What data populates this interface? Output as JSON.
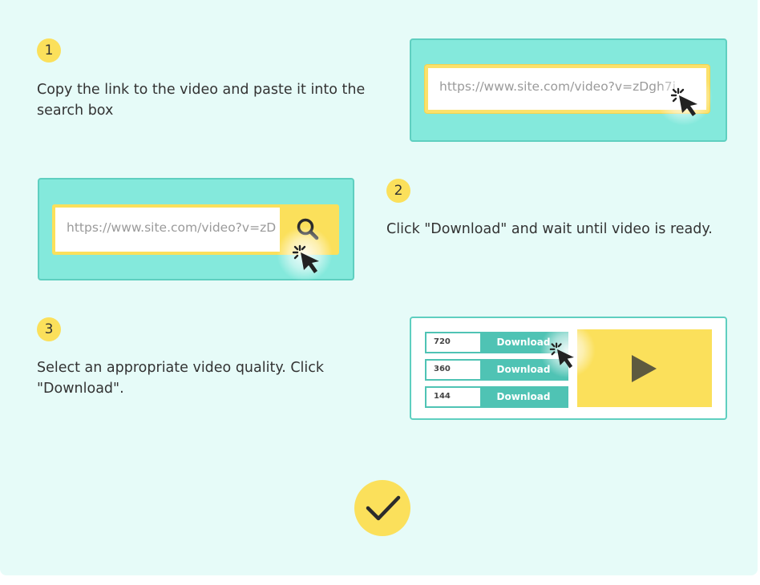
{
  "steps": [
    {
      "number": "1",
      "text": "Copy the link to the video and paste it into the search box"
    },
    {
      "number": "2",
      "text": "Click \"Download\" and wait until video is ready."
    },
    {
      "number": "3",
      "text": "Select an appropriate video quality. Click \"Download\"."
    }
  ],
  "step1_card": {
    "url": "https://www.site.com/video?v=zDgh7i"
  },
  "step2_card": {
    "url": "https://www.site.com/video?v=zD"
  },
  "step3_card": {
    "qualities": [
      {
        "quality": "720",
        "button": "Download"
      },
      {
        "quality": "360",
        "button": "Download"
      },
      {
        "quality": "144",
        "button": "Download"
      }
    ]
  },
  "icons": {
    "search": "search-icon",
    "cursor": "cursor-click-icon",
    "play": "play-icon",
    "check": "check-icon"
  },
  "colors": {
    "panel_bg": "#e6fbf8",
    "teal": "#84e9dc",
    "teal_dark": "#4fc3b4",
    "yellow": "#fbe05b",
    "text": "#333333"
  }
}
